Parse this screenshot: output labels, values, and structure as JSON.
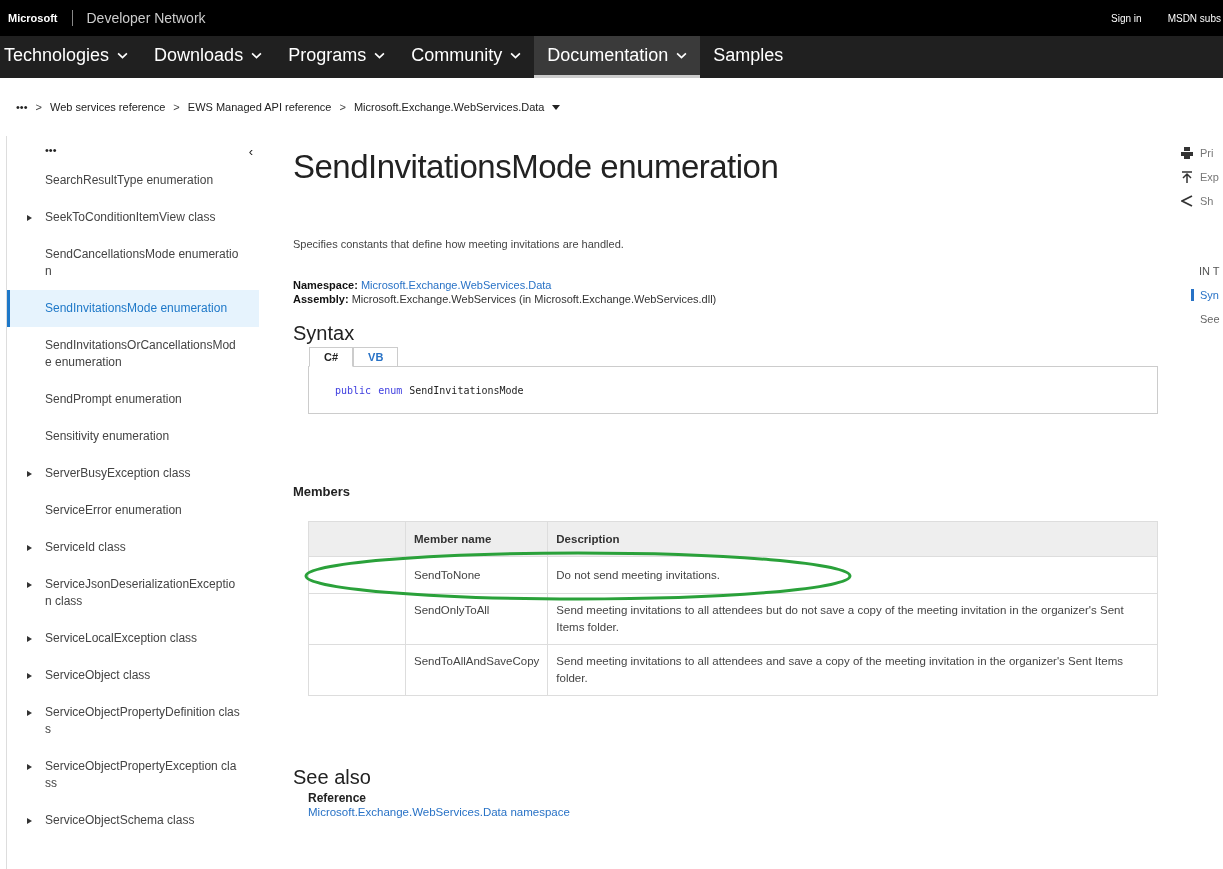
{
  "header": {
    "brand": "Microsoft",
    "site": "Developer Network",
    "sign_in": "Sign in",
    "subscription": "MSDN subs"
  },
  "nav": [
    {
      "label": "Technologies",
      "has_menu": true,
      "selected": false
    },
    {
      "label": "Downloads",
      "has_menu": true,
      "selected": false
    },
    {
      "label": "Programs",
      "has_menu": true,
      "selected": false
    },
    {
      "label": "Community",
      "has_menu": true,
      "selected": false
    },
    {
      "label": "Documentation",
      "has_menu": true,
      "selected": true
    },
    {
      "label": "Samples",
      "has_menu": false,
      "selected": false
    }
  ],
  "breadcrumb": {
    "more": "•••",
    "items": [
      "Web services reference",
      "EWS Managed API reference",
      "Microsoft.Exchange.WebServices.Data"
    ],
    "separator": ">"
  },
  "sidebar": {
    "more": "•••",
    "collapse": "‹",
    "items": [
      {
        "label": "SearchResultType enumeration",
        "expandable": false,
        "selected": false
      },
      {
        "label": "SeekToConditionItemView class",
        "expandable": true,
        "selected": false
      },
      {
        "label": "SendCancellationsMode enumeration",
        "expandable": false,
        "selected": false
      },
      {
        "label": "SendInvitationsMode enumeration",
        "expandable": false,
        "selected": true
      },
      {
        "label": "SendInvitationsOrCancellationsMode enumeration",
        "expandable": false,
        "selected": false
      },
      {
        "label": "SendPrompt enumeration",
        "expandable": false,
        "selected": false
      },
      {
        "label": "Sensitivity enumeration",
        "expandable": false,
        "selected": false
      },
      {
        "label": "ServerBusyException class",
        "expandable": true,
        "selected": false
      },
      {
        "label": "ServiceError enumeration",
        "expandable": false,
        "selected": false
      },
      {
        "label": "ServiceId class",
        "expandable": true,
        "selected": false
      },
      {
        "label": "ServiceJsonDeserializationException class",
        "expandable": true,
        "selected": false
      },
      {
        "label": "ServiceLocalException class",
        "expandable": true,
        "selected": false
      },
      {
        "label": "ServiceObject class",
        "expandable": true,
        "selected": false
      },
      {
        "label": "ServiceObjectPropertyDefinition class",
        "expandable": true,
        "selected": false
      },
      {
        "label": "ServiceObjectPropertyException class",
        "expandable": true,
        "selected": false
      },
      {
        "label": "ServiceObjectSchema class",
        "expandable": true,
        "selected": false
      }
    ]
  },
  "article": {
    "title": "SendInvitationsMode enumeration",
    "summary": "Specifies constants that define how meeting invitations are handled.",
    "namespace_label": "Namespace:",
    "namespace": "Microsoft.Exchange.WebServices.Data",
    "assembly_label": "Assembly:",
    "assembly": "Microsoft.Exchange.WebServices (in Microsoft.Exchange.WebServices.dll)",
    "syntax_heading": "Syntax",
    "code_tabs": [
      {
        "label": "C#",
        "selected": true
      },
      {
        "label": "VB",
        "selected": false
      }
    ],
    "code": [
      {
        "text": "public",
        "kind": "keyword"
      },
      {
        "text": "enum",
        "kind": "keyword"
      },
      {
        "text": "SendInvitationsMode",
        "kind": "name"
      }
    ],
    "members_heading": "Members",
    "members_columns": [
      "Member name",
      "Description"
    ],
    "members": [
      {
        "name": "SendToNone",
        "description": "Do not send meeting invitations.",
        "circled": true
      },
      {
        "name": "SendOnlyToAll",
        "description": "Send meeting invitations to all attendees but do not save a copy of the meeting invitation in the organizer's Sent Items folder.",
        "circled": false
      },
      {
        "name": "SendToAllAndSaveCopy",
        "description": "Send meeting invitations to all attendees and save a copy of the meeting invitation in the organizer's Sent Items folder.",
        "circled": false
      }
    ],
    "see_also_heading": "See also",
    "reference_label": "Reference",
    "reference_link": "Microsoft.Exchange.WebServices.Data namespace"
  },
  "right_rail": {
    "actions": [
      {
        "label": "Pri",
        "kind": "print"
      },
      {
        "label": "Exp",
        "kind": "export"
      },
      {
        "label": "Sh",
        "kind": "share"
      }
    ],
    "toc_heading": "IN T",
    "toc": [
      {
        "label": "Syn",
        "selected": true
      },
      {
        "label": "See",
        "selected": false
      }
    ]
  }
}
